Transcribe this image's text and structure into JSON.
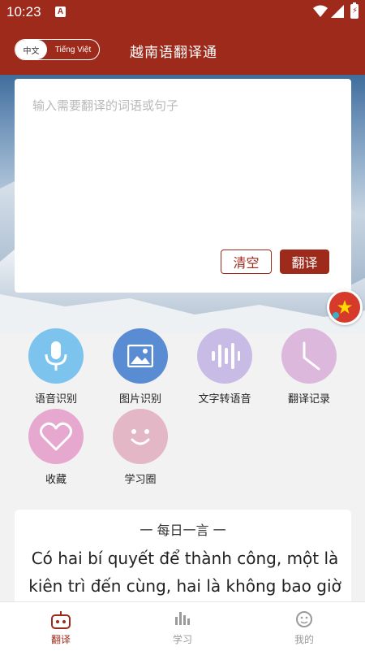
{
  "status_bar": {
    "time": "10:23",
    "notification_icon": "A"
  },
  "header": {
    "title": "越南语翻译通",
    "lang_toggle": {
      "active": "中文",
      "inactive": "Tiếng Việt"
    }
  },
  "translator": {
    "placeholder": "输入需要翻译的词语或句子",
    "clear_label": "清空",
    "translate_label": "翻译"
  },
  "features": [
    {
      "label": "语音识别",
      "icon": "microphone-icon",
      "color": "#7cc3ee"
    },
    {
      "label": "图片识别",
      "icon": "image-icon",
      "color": "#5a8cd4"
    },
    {
      "label": "文字转语音",
      "icon": "sound-wave-icon",
      "color": "#c8bce6"
    },
    {
      "label": "翻译记录",
      "icon": "clock-icon",
      "color": "#dcb8dc"
    },
    {
      "label": "收藏",
      "icon": "heart-icon",
      "color": "#e7a8cf"
    },
    {
      "label": "学习圈",
      "icon": "smiley-icon",
      "color": "#e3b7c6"
    }
  ],
  "daily_quote": {
    "heading": "一  每日一言  一",
    "text": "Có hai bí quyết để thành công, một là kiên trì đến cùng, hai là không bao giờ"
  },
  "bottom_nav": [
    {
      "label": "翻译",
      "icon": "robot-icon",
      "active": true
    },
    {
      "label": "学习",
      "icon": "bar-chart-icon",
      "active": false
    },
    {
      "label": "我的",
      "icon": "face-icon",
      "active": false
    }
  ],
  "colors": {
    "primary": "#9e2a1b",
    "background": "#f2f2f2"
  }
}
